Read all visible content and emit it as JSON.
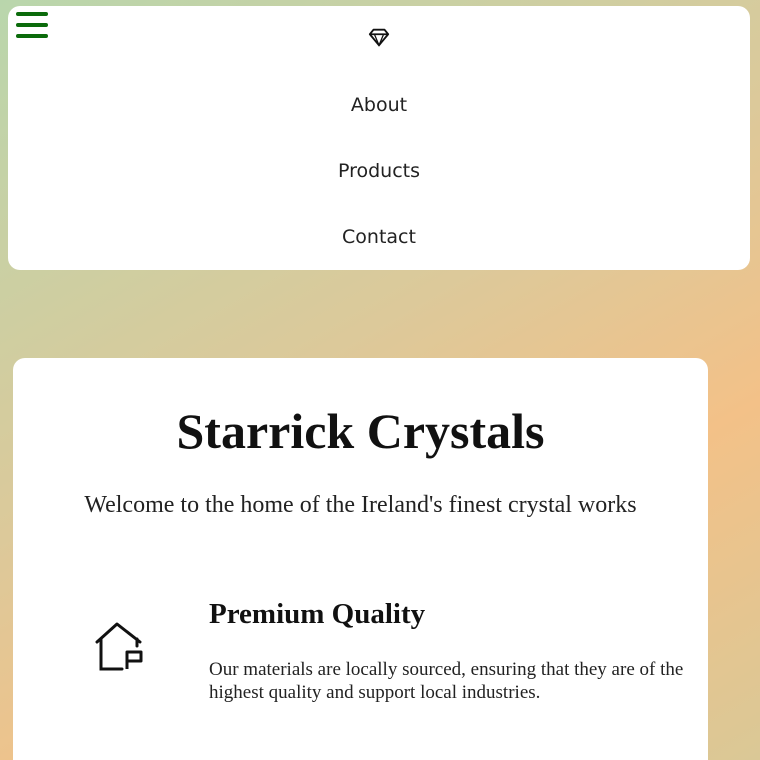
{
  "nav": {
    "toggle_icon": "hamburger-menu-icon",
    "logo_icon": "diamond-icon",
    "links": [
      {
        "label": "About"
      },
      {
        "label": "Products"
      },
      {
        "label": "Contact"
      }
    ]
  },
  "hero": {
    "title": "Starrick Crystals",
    "tagline": "Welcome to the home of the Ireland's finest crystal works"
  },
  "features": [
    {
      "icon": "house-p-icon",
      "title": "Premium Quality",
      "text": "Our materials are locally sourced, ensuring that they are of the highest quality and support local industries."
    }
  ],
  "colors": {
    "menu_icon": "#0b6b0b",
    "card_background": "#ffffff",
    "gradient_left": "#b9d6ac",
    "gradient_right": "#f3c188"
  }
}
